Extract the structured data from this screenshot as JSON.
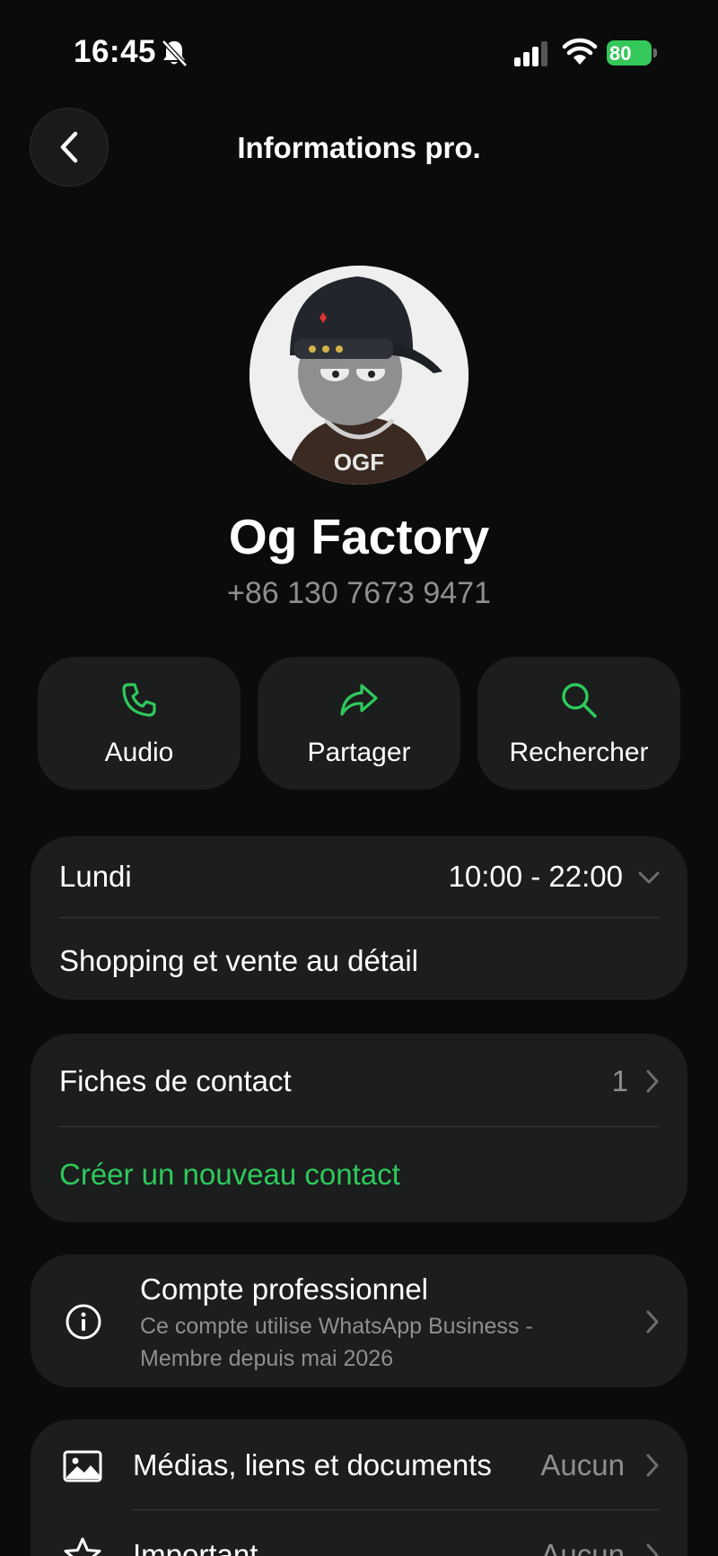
{
  "status_bar": {
    "time": "16:45",
    "battery": "80"
  },
  "header": {
    "title": "Informations pro."
  },
  "profile": {
    "name": "Og Factory",
    "phone": "+86 130 7673 9471",
    "avatar_text": "OGF"
  },
  "actions": [
    {
      "label": "Audio",
      "icon": "phone-icon"
    },
    {
      "label": "Partager",
      "icon": "share-icon"
    },
    {
      "label": "Rechercher",
      "icon": "search-icon"
    }
  ],
  "hours": {
    "day": "Lundi",
    "time": "10:00 - 22:00",
    "category": "Shopping et vente au détail"
  },
  "contacts": {
    "label": "Fiches de contact",
    "count": "1",
    "create_label": "Créer un nouveau contact"
  },
  "business_account": {
    "title": "Compte professionnel",
    "line1": "Ce compte utilise WhatsApp Business -",
    "line2": "Membre depuis mai 2026"
  },
  "media": {
    "label": "Médias, liens et documents",
    "value": "Aucun"
  },
  "important": {
    "label": "Important",
    "value": "Aucun"
  },
  "colors": {
    "accent": "#2ec95c",
    "background": "#0b0b0b",
    "card": "#1c1d1d",
    "muted": "#8e8e93"
  }
}
